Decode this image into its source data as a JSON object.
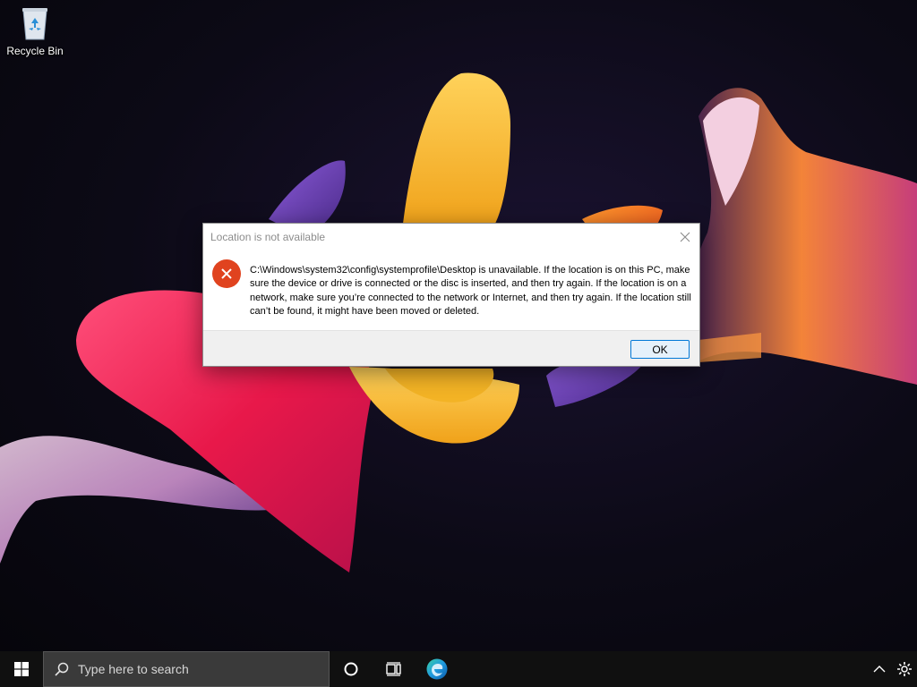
{
  "desktop": {
    "icons": [
      {
        "label": "Recycle Bin",
        "icon": "recycle-bin-icon"
      }
    ]
  },
  "dialog": {
    "title": "Location is not available",
    "message": "C:\\Windows\\system32\\config\\systemprofile\\Desktop is unavailable. If the location is on this PC, make sure the device or drive is connected or the disc is inserted, and then try again. If the location is on a network, make sure you’re connected to the network or Internet, and then try again. If the location still can’t be found, it might have been moved or deleted.",
    "ok_label": "OK",
    "icon": "error-icon",
    "close_icon": "close-icon"
  },
  "taskbar": {
    "search_placeholder": "Type here to search",
    "start_icon": "windows-start-icon",
    "cortana_icon": "cortana-icon",
    "task_view_icon": "task-view-icon",
    "edge_icon": "edge-browser-icon",
    "tray_icons": [
      "chevron-up-icon",
      "settings-gear-icon"
    ]
  },
  "colors": {
    "error_red": "#e0431f",
    "button_border": "#0078d7",
    "taskbar_bg": "#101010"
  }
}
